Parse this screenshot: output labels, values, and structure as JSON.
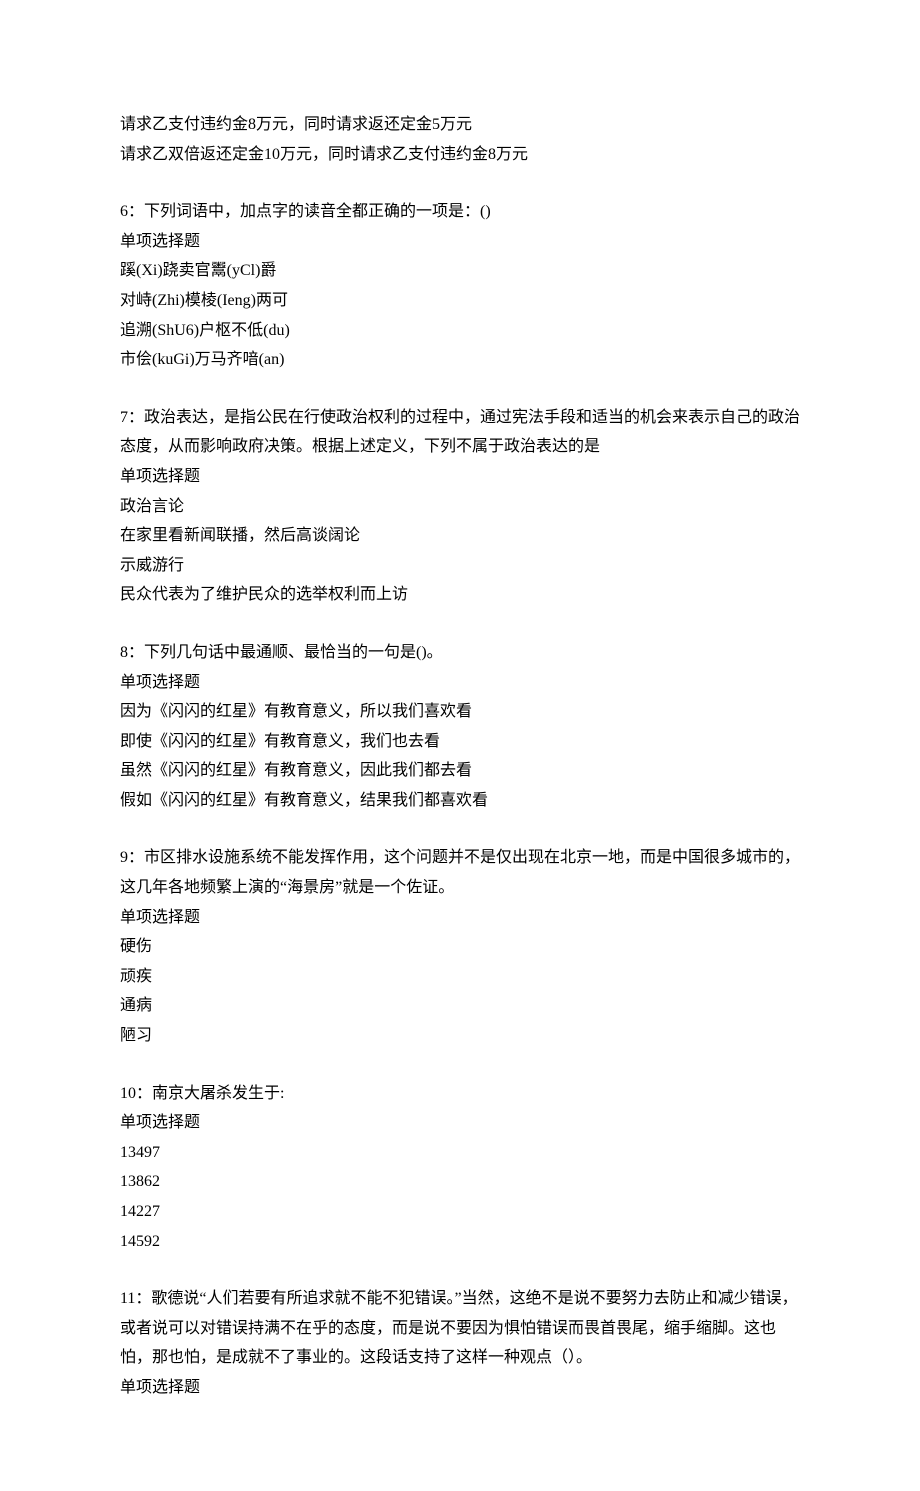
{
  "q5_trailing": {
    "lines": [
      "请求乙支付违约金8万元，同时请求返还定金5万元",
      "请求乙双倍返还定金10万元，同时请求乙支付违约金8万元"
    ]
  },
  "q6": {
    "prompt": "6：下列词语中，加点字的读音全都正确的一项是：()",
    "type": "单项选择题",
    "options": [
      "蹊(Xi)跷卖官鬻(yCl)爵",
      "对峙(Zhi)模棱(Ieng)两可",
      "追溯(ShU6)户枢不低(du)",
      "市侩(kuGi)万马齐喑(an)"
    ]
  },
  "q7": {
    "prompt": "7：政治表达，是指公民在行使政治权利的过程中，通过宪法手段和适当的机会来表示自己的政治态度，从而影响政府决策。根据上述定义，下列不属于政治表达的是",
    "type": "单项选择题",
    "options": [
      "政治言论",
      "在家里看新闻联播，然后高谈阔论",
      "示威游行",
      "民众代表为了维护民众的选举权利而上访"
    ]
  },
  "q8": {
    "prompt": "8：下列几句话中最通顺、最恰当的一句是()。",
    "type": "单项选择题",
    "options": [
      "因为《闪闪的红星》有教育意义，所以我们喜欢看",
      "即使《闪闪的红星》有教育意义，我们也去看",
      "虽然《闪闪的红星》有教育意义，因此我们都去看",
      "假如《闪闪的红星》有教育意义，结果我们都喜欢看"
    ]
  },
  "q9": {
    "prompt": "9：市区排水设施系统不能发挥作用，这个问题并不是仅出现在北京一地，而是中国很多城市的，这几年各地频繁上演的“海景房”就是一个佐证。",
    "type": "单项选择题",
    "options": [
      "硬伤",
      "顽疾",
      "通病",
      "陋习"
    ]
  },
  "q10": {
    "prompt": "10：南京大屠杀发生于:",
    "type": "单项选择题",
    "options": [
      "13497",
      "13862",
      "14227",
      "14592"
    ]
  },
  "q11": {
    "prompt": "11：歌德说“人们若要有所追求就不能不犯错误。”当然，这绝不是说不要努力去防止和减少错误，或者说可以对错误持满不在乎的态度，而是说不要因为惧怕错误而畏首畏尾，缩手缩脚。这也怕，那也怕，是成就不了事业的。这段话支持了这样一种观点（）。",
    "type": "单项选择题"
  }
}
